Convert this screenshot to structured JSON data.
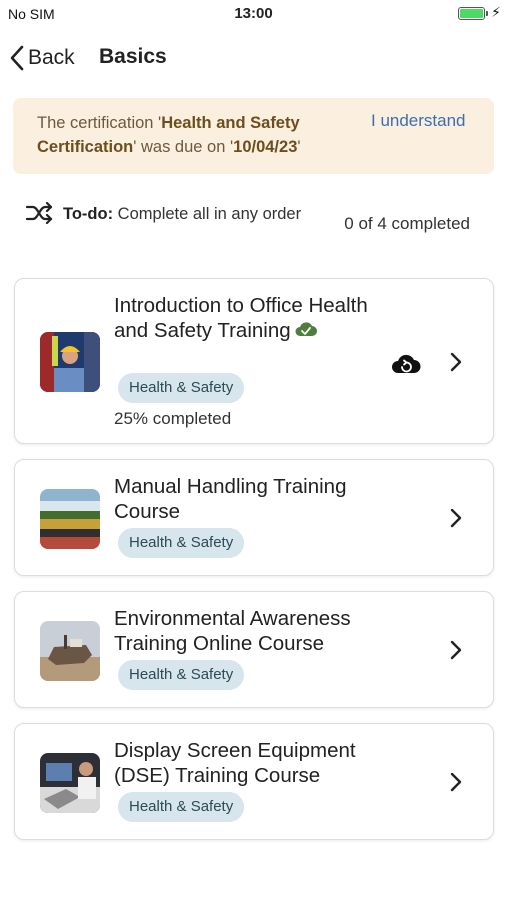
{
  "status_bar": {
    "carrier": "No SIM",
    "time": "13:00",
    "battery_level": 1.0,
    "battery_color": "#4cd964"
  },
  "nav": {
    "back_label": "Back",
    "title": "Basics",
    "back_icon": "chevron-left-icon"
  },
  "alert": {
    "text_prefix": "The certification '",
    "cert_name": "Health and Safety Certification",
    "text_middle": "' was due on '",
    "due_date": "10/04/23",
    "text_suffix": "'",
    "action_label": "I understand",
    "background": "#fbefe0",
    "action_color": "#3a6fb0"
  },
  "todo": {
    "icon": "shuffle-icon",
    "label": "To-do:",
    "text": " Complete all in any order",
    "progress": "0 of 4 completed"
  },
  "courses": [
    {
      "title": "Introduction to Office Health and Safety Training",
      "tag": "Health & Safety",
      "progress_text": "25% completed",
      "downloaded_icon": "cloud-check-icon",
      "sync_icon": "cloud-sync-icon"
    },
    {
      "title": "Manual Handling Training Course",
      "tag": "Health & Safety"
    },
    {
      "title": "Environmental Awareness Training Online Course",
      "tag": "Health & Safety"
    },
    {
      "title": "Display Screen Equipment (DSE) Training Course",
      "tag": "Health & Safety"
    }
  ],
  "colors": {
    "tag_background": "#d6e6ec",
    "downloaded_check": "#4e7d3e"
  }
}
